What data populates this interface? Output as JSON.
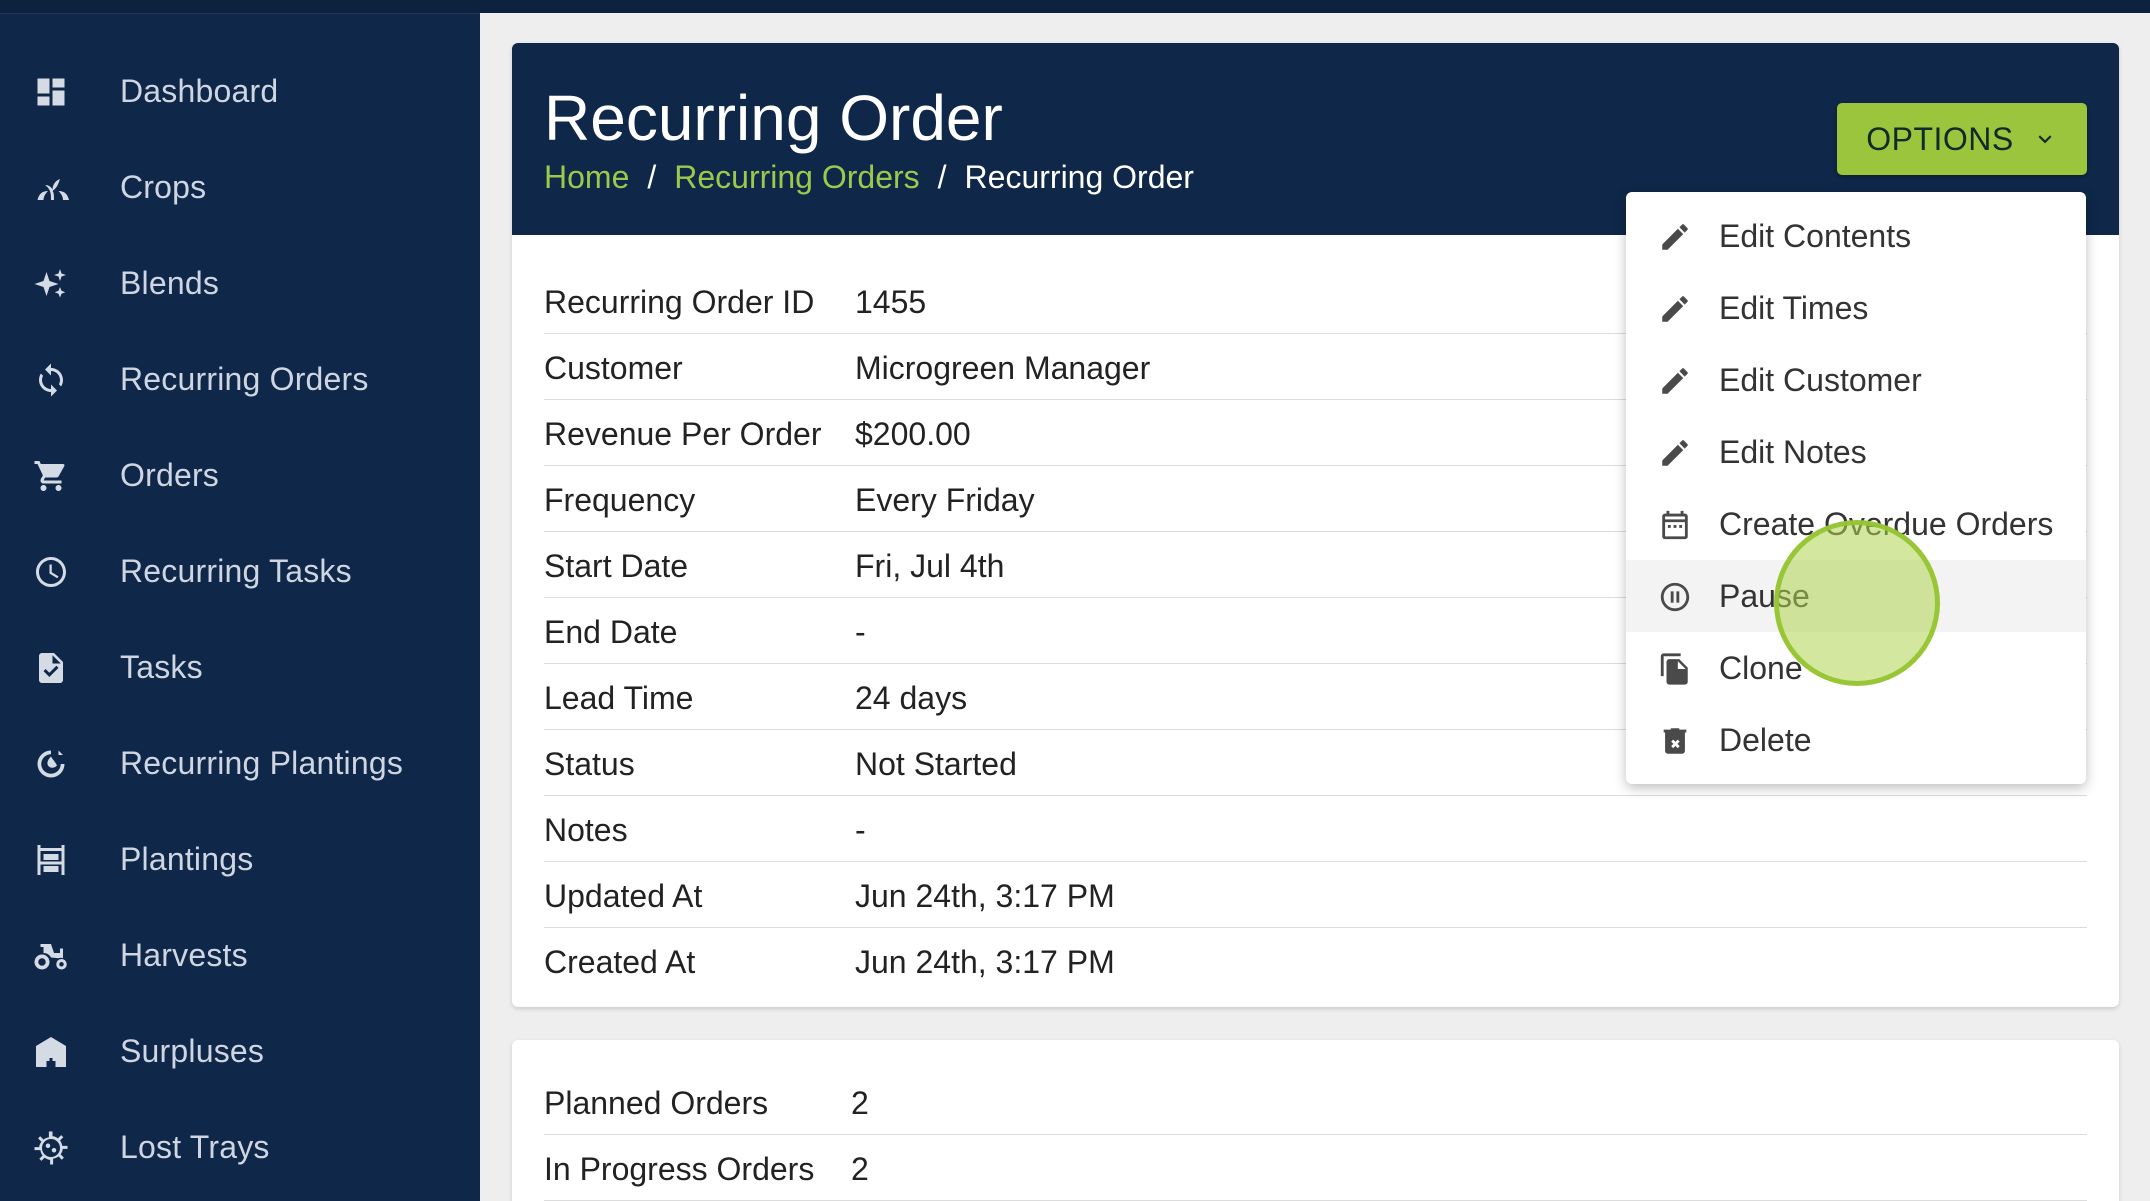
{
  "sidebar": {
    "items": [
      {
        "label": "Dashboard",
        "icon": "dashboard-icon"
      },
      {
        "label": "Crops",
        "icon": "sprout-icon"
      },
      {
        "label": "Blends",
        "icon": "sparkles-icon"
      },
      {
        "label": "Recurring Orders",
        "icon": "refresh-icon"
      },
      {
        "label": "Orders",
        "icon": "cart-icon"
      },
      {
        "label": "Recurring Tasks",
        "icon": "clock-icon"
      },
      {
        "label": "Tasks",
        "icon": "file-check-icon"
      },
      {
        "label": "Recurring Plantings",
        "icon": "seed-cycle-icon"
      },
      {
        "label": "Plantings",
        "icon": "shelves-icon"
      },
      {
        "label": "Harvests",
        "icon": "tractor-icon"
      },
      {
        "label": "Surpluses",
        "icon": "store-icon"
      },
      {
        "label": "Lost Trays",
        "icon": "virus-icon"
      }
    ]
  },
  "header": {
    "title": "Recurring Order",
    "breadcrumb": {
      "home": "Home",
      "parent": "Recurring Orders",
      "current": "Recurring Order",
      "separator": "/"
    },
    "options_label": "OPTIONS"
  },
  "details": [
    {
      "label": "Recurring Order ID",
      "value": "1455"
    },
    {
      "label": "Customer",
      "value": "Microgreen Manager"
    },
    {
      "label": "Revenue Per Order",
      "value": "$200.00"
    },
    {
      "label": "Frequency",
      "value": "Every Friday"
    },
    {
      "label": "Start Date",
      "value": "Fri, Jul 4th"
    },
    {
      "label": "End Date",
      "value": "-"
    },
    {
      "label": "Lead Time",
      "value": "24 days"
    },
    {
      "label": "Status",
      "value": "Not Started"
    },
    {
      "label": "Notes",
      "value": "-"
    },
    {
      "label": "Updated At",
      "value": "Jun 24th, 3:17 PM"
    },
    {
      "label": "Created At",
      "value": "Jun 24th, 3:17 PM"
    }
  ],
  "summary": [
    {
      "label": "Planned Orders",
      "value": "2"
    },
    {
      "label": "In Progress Orders",
      "value": "2"
    }
  ],
  "options_menu": [
    {
      "label": "Edit Contents",
      "icon": "pencil-icon"
    },
    {
      "label": "Edit Times",
      "icon": "pencil-icon"
    },
    {
      "label": "Edit Customer",
      "icon": "pencil-icon"
    },
    {
      "label": "Edit Notes",
      "icon": "pencil-icon"
    },
    {
      "label": "Create Overdue Orders",
      "icon": "calendar-icon"
    },
    {
      "label": "Pause",
      "icon": "pause-circle-icon"
    },
    {
      "label": "Clone",
      "icon": "copy-icon"
    },
    {
      "label": "Delete",
      "icon": "trash-icon"
    }
  ],
  "colors": {
    "sidebar_bg": "#0f2748",
    "header_bg": "#0f2748",
    "accent_green": "#9bc53d",
    "link_green": "#9cc94b"
  }
}
